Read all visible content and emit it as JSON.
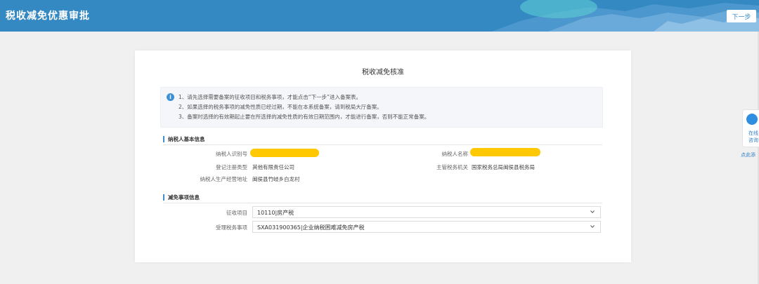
{
  "header": {
    "title": "税收减免优惠审批",
    "next_label": "下一步"
  },
  "card": {
    "title": "税收减免核准"
  },
  "notice": {
    "lines": [
      "1、请先选择需要备案的征收项目和税务事项，才能点击“下一步”进入备案表。",
      "2、如果选择的税务事项的减免性质已经过期，不能在本系统备案，请到税局大厅备案。",
      "3、备案时选择的有效期起止要在所选择的减免性质的有效日期范围内，才能进行备案，否则不能正常备案。"
    ]
  },
  "taxpayer": {
    "section_title": "纳税人基本信息",
    "id_label": "纳税人识别号",
    "name_label": "纳税人名称",
    "reg_type_label": "登记注册类型",
    "reg_type_value": "其他有限责任公司",
    "authority_label": "主管税务机关",
    "authority_value": "国家税务总局闽侯县税务局",
    "address_label": "纳税人生产经营地址",
    "address_value": "闽侯县竹岐乡白龙村"
  },
  "exemption": {
    "section_title": "减免事项信息",
    "levy_label": "征收项目",
    "levy_value": "10110|房产税",
    "matter_label": "受理税务事项",
    "matter_value": "SXA031900365|企业纳税困难减免房产税"
  },
  "float_panel": {
    "line1": "在线",
    "line2": "咨询",
    "link": "点此添"
  },
  "colors": {
    "header_bg": "#3589c3",
    "accent": "#3d8fd6",
    "redaction": "#ffc800"
  }
}
